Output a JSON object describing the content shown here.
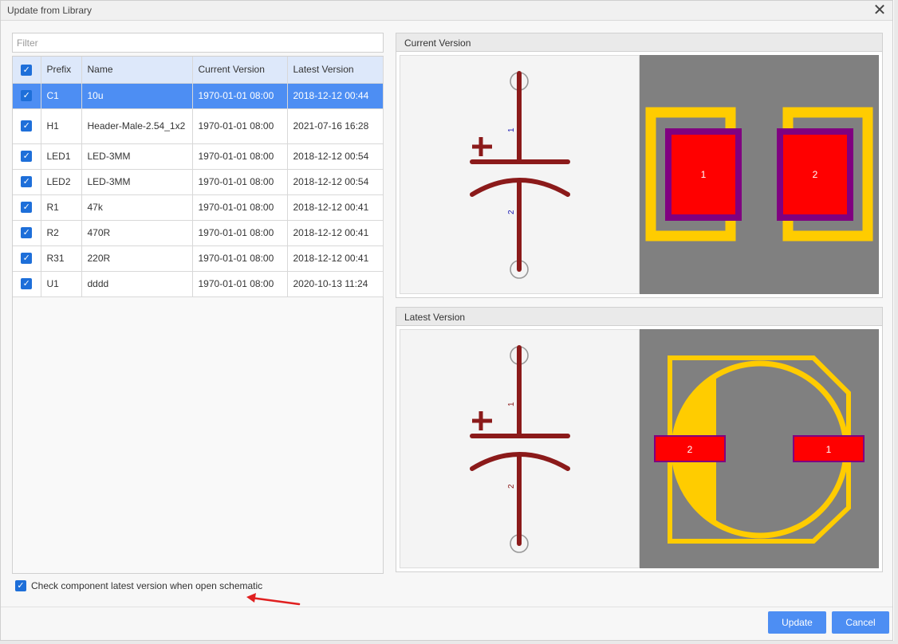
{
  "dialog": {
    "title": "Update from Library",
    "close_icon": "close-icon"
  },
  "filter": {
    "placeholder": "Filter",
    "value": ""
  },
  "table": {
    "columns": [
      "Prefix",
      "Name",
      "Current Version",
      "Latest Version"
    ],
    "rows": [
      {
        "prefix": "C1",
        "name": "10u",
        "current": "1970-01-01 08:00",
        "latest": "2018-12-12 00:44",
        "checked": true,
        "selected": true
      },
      {
        "prefix": "H1",
        "name": "Header-Male-2.54_1x2",
        "current": "1970-01-01 08:00",
        "latest": "2021-07-16 16:28",
        "checked": true,
        "selected": false
      },
      {
        "prefix": "LED1",
        "name": "LED-3MM",
        "current": "1970-01-01 08:00",
        "latest": "2018-12-12 00:54",
        "checked": true,
        "selected": false
      },
      {
        "prefix": "LED2",
        "name": "LED-3MM",
        "current": "1970-01-01 08:00",
        "latest": "2018-12-12 00:54",
        "checked": true,
        "selected": false
      },
      {
        "prefix": "R1",
        "name": "47k",
        "current": "1970-01-01 08:00",
        "latest": "2018-12-12 00:41",
        "checked": true,
        "selected": false
      },
      {
        "prefix": "R2",
        "name": "470R",
        "current": "1970-01-01 08:00",
        "latest": "2018-12-12 00:41",
        "checked": true,
        "selected": false
      },
      {
        "prefix": "R31",
        "name": "220R",
        "current": "1970-01-01 08:00",
        "latest": "2018-12-12 00:41",
        "checked": true,
        "selected": false
      },
      {
        "prefix": "U1",
        "name": "dddd",
        "current": "1970-01-01 08:00",
        "latest": "2020-10-13 11:24",
        "checked": true,
        "selected": false
      }
    ]
  },
  "footer": {
    "check_label": "Check component latest version when open schematic",
    "check_checked": true,
    "update_label": "Update",
    "cancel_label": "Cancel"
  },
  "preview": {
    "current_title": "Current Version",
    "latest_title": "Latest Version",
    "current_pads": [
      "1",
      "2"
    ],
    "latest_pads": [
      "2",
      "1"
    ],
    "pin_labels": [
      "1",
      "2"
    ]
  },
  "colors": {
    "accent": "#4d8ef3",
    "header_bg": "#dde8fa",
    "schematic_wire": "#8b1a1a",
    "pad": "#ff0000",
    "silkscreen": "#ffcc00",
    "pcb_bg": "#808080"
  }
}
